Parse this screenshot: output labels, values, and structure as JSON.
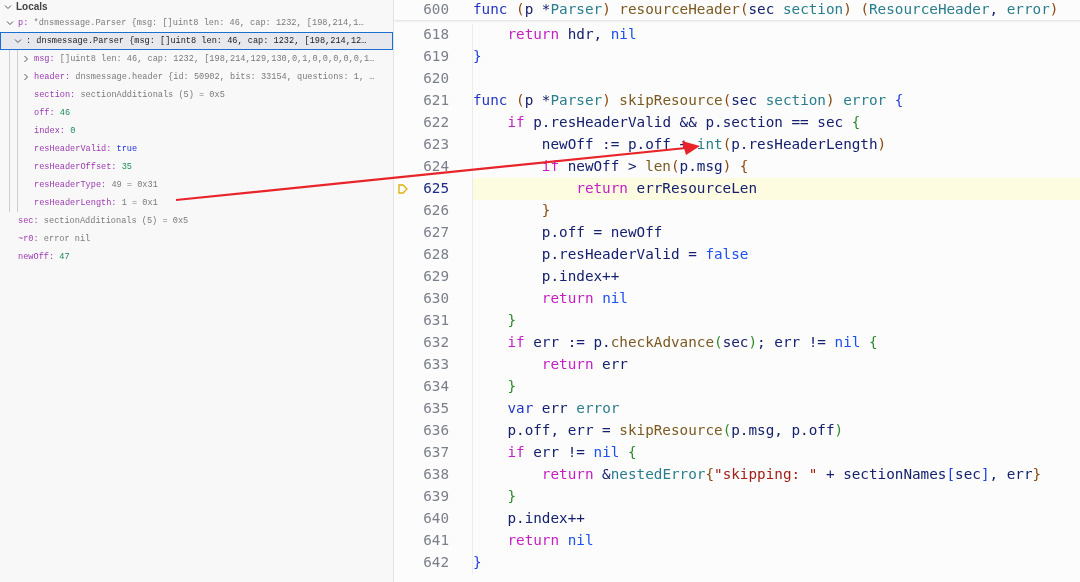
{
  "variables_panel": {
    "section_title": "Locals",
    "section_expanded": true,
    "variables": [
      {
        "name": "p:",
        "value": "*dnsmessage.Parser {msg: []uint8 len: 46, cap: 1232, [198,214,1…",
        "kind": "plain",
        "expanded": true,
        "selected": false,
        "children": [
          {
            "value": ": dnsmessage.Parser {msg: []uint8 len: 46, cap: 1232, [198,214,12…",
            "kind": "strong",
            "expanded": true,
            "selected": true,
            "children": [
              {
                "name": "msg:",
                "value": "[]uint8 len: 46, cap: 1232, [198,214,129,130,0,1,0,0,0,0,0,1…",
                "kind": "plain",
                "expanded": false,
                "selected": false
              },
              {
                "name": "header:",
                "value": "dnsmessage.header {id: 50902, bits: 33154, questions: 1, …",
                "kind": "plain",
                "expanded": false,
                "selected": false
              },
              {
                "name": "section:",
                "value": "sectionAdditionals (5) = 0x5",
                "kind": "plain",
                "selected": false
              },
              {
                "name": "off:",
                "value": "46",
                "kind": "number",
                "selected": false
              },
              {
                "name": "index:",
                "value": "0",
                "kind": "number",
                "selected": false
              },
              {
                "name": "resHeaderValid:",
                "value": "true",
                "kind": "bool",
                "selected": false
              },
              {
                "name": "resHeaderOffset:",
                "value": "35",
                "kind": "number",
                "selected": false
              },
              {
                "name": "resHeaderType:",
                "value": "49 = 0x31",
                "kind": "plain",
                "selected": false
              },
              {
                "name": "resHeaderLength:",
                "value": "1 = 0x1",
                "kind": "plain",
                "selected": false
              }
            ]
          }
        ]
      },
      {
        "name": "sec:",
        "value": "sectionAdditionals (5) = 0x5",
        "kind": "plain",
        "selected": false
      },
      {
        "name": "~r0:",
        "value": "error nil",
        "kind": "plain",
        "selected": false
      },
      {
        "name": "newOff:",
        "value": "47",
        "kind": "number",
        "selected": false
      }
    ]
  },
  "editor": {
    "sticky_line": {
      "number": "600",
      "tokens": [
        {
          "kind": "kw1",
          "text": "func "
        },
        {
          "kind": "b2",
          "text": "("
        },
        {
          "kind": "id",
          "text": "p *"
        },
        {
          "kind": "type",
          "text": "Parser"
        },
        {
          "kind": "b2",
          "text": ") "
        },
        {
          "kind": "fn",
          "text": "resourceHeader"
        },
        {
          "kind": "b2",
          "text": "("
        },
        {
          "kind": "id",
          "text": "sec "
        },
        {
          "kind": "type",
          "text": "section"
        },
        {
          "kind": "b2",
          "text": ") ("
        },
        {
          "kind": "type",
          "text": "ResourceHeader"
        },
        {
          "kind": "id",
          "text": ", "
        },
        {
          "kind": "type",
          "text": "error"
        },
        {
          "kind": "b2",
          "text": ")"
        }
      ]
    },
    "lines": [
      {
        "number": "618",
        "current": false,
        "tokens": [
          {
            "kind": "kw2",
            "text": "    return"
          },
          {
            "kind": "id",
            "text": " hdr, "
          },
          {
            "kind": "lit",
            "text": "nil"
          }
        ]
      },
      {
        "number": "619",
        "current": false,
        "tokens": [
          {
            "kind": "b3",
            "text": "}"
          }
        ]
      },
      {
        "number": "620",
        "current": false
      },
      {
        "number": "621",
        "current": false,
        "tokens": [
          {
            "kind": "kw1",
            "text": "func "
          },
          {
            "kind": "b2",
            "text": "("
          },
          {
            "kind": "id",
            "text": "p *"
          },
          {
            "kind": "type",
            "text": "Parser"
          },
          {
            "kind": "b2",
            "text": ") "
          },
          {
            "kind": "fn",
            "text": "skipResource"
          },
          {
            "kind": "b2",
            "text": "("
          },
          {
            "kind": "id",
            "text": "sec "
          },
          {
            "kind": "type",
            "text": "section"
          },
          {
            "kind": "b2",
            "text": ") "
          },
          {
            "kind": "type",
            "text": "error "
          },
          {
            "kind": "b3",
            "text": "{"
          }
        ]
      },
      {
        "number": "622",
        "current": false,
        "tokens": [
          {
            "kind": "kw2",
            "text": "    if"
          },
          {
            "kind": "id",
            "text": " p.resHeaderValid && p.section == sec "
          },
          {
            "kind": "b1",
            "text": "{"
          }
        ]
      },
      {
        "number": "623",
        "current": false,
        "tokens": [
          {
            "kind": "id",
            "text": "        newOff := p.off + "
          },
          {
            "kind": "type",
            "text": "int"
          },
          {
            "kind": "b2",
            "text": "("
          },
          {
            "kind": "id",
            "text": "p.resHeaderLength"
          },
          {
            "kind": "b2",
            "text": ")"
          }
        ]
      },
      {
        "number": "624",
        "current": false,
        "tokens": [
          {
            "kind": "kw2",
            "text": "        if"
          },
          {
            "kind": "id",
            "text": " newOff > "
          },
          {
            "kind": "fn",
            "text": "len"
          },
          {
            "kind": "b2",
            "text": "("
          },
          {
            "kind": "id",
            "text": "p.msg"
          },
          {
            "kind": "b2",
            "text": ") {"
          }
        ]
      },
      {
        "number": "625",
        "current": true,
        "tokens": [
          {
            "kind": "kw2",
            "text": "            return"
          },
          {
            "kind": "id",
            "text": " errResourceLen"
          }
        ]
      },
      {
        "number": "626",
        "current": false,
        "tokens": [
          {
            "kind": "b2",
            "text": "        }"
          }
        ]
      },
      {
        "number": "627",
        "current": false,
        "tokens": [
          {
            "kind": "id",
            "text": "        p.off = newOff"
          }
        ]
      },
      {
        "number": "628",
        "current": false,
        "tokens": [
          {
            "kind": "id",
            "text": "        p.resHeaderValid = "
          },
          {
            "kind": "lit",
            "text": "false"
          }
        ]
      },
      {
        "number": "629",
        "current": false,
        "tokens": [
          {
            "kind": "id",
            "text": "        p.index++"
          }
        ]
      },
      {
        "number": "630",
        "current": false,
        "tokens": [
          {
            "kind": "kw2",
            "text": "        return "
          },
          {
            "kind": "lit",
            "text": "nil"
          }
        ]
      },
      {
        "number": "631",
        "current": false,
        "tokens": [
          {
            "kind": "b1",
            "text": "    }"
          }
        ]
      },
      {
        "number": "632",
        "current": false,
        "tokens": [
          {
            "kind": "kw2",
            "text": "    if"
          },
          {
            "kind": "id",
            "text": " err := p."
          },
          {
            "kind": "fn",
            "text": "checkAdvance"
          },
          {
            "kind": "b1",
            "text": "("
          },
          {
            "kind": "id",
            "text": "sec"
          },
          {
            "kind": "b1",
            "text": ")"
          },
          {
            "kind": "id",
            "text": "; err != "
          },
          {
            "kind": "lit",
            "text": "nil "
          },
          {
            "kind": "b1",
            "text": "{"
          }
        ]
      },
      {
        "number": "633",
        "current": false,
        "tokens": [
          {
            "kind": "kw2",
            "text": "        return"
          },
          {
            "kind": "id",
            "text": " err"
          }
        ]
      },
      {
        "number": "634",
        "current": false,
        "tokens": [
          {
            "kind": "b1",
            "text": "    }"
          }
        ]
      },
      {
        "number": "635",
        "current": false,
        "tokens": [
          {
            "kind": "kw1",
            "text": "    var"
          },
          {
            "kind": "id",
            "text": " err "
          },
          {
            "kind": "type",
            "text": "error"
          }
        ]
      },
      {
        "number": "636",
        "current": false,
        "tokens": [
          {
            "kind": "id",
            "text": "    p.off, err = "
          },
          {
            "kind": "fn",
            "text": "skipResource"
          },
          {
            "kind": "b1",
            "text": "("
          },
          {
            "kind": "id",
            "text": "p.msg, p.off"
          },
          {
            "kind": "b1",
            "text": ")"
          }
        ]
      },
      {
        "number": "637",
        "current": false,
        "tokens": [
          {
            "kind": "kw2",
            "text": "    if"
          },
          {
            "kind": "id",
            "text": " err != "
          },
          {
            "kind": "lit",
            "text": "nil "
          },
          {
            "kind": "b1",
            "text": "{"
          }
        ]
      },
      {
        "number": "638",
        "current": false,
        "tokens": [
          {
            "kind": "kw2",
            "text": "        return"
          },
          {
            "kind": "id",
            "text": " &"
          },
          {
            "kind": "type",
            "text": "nestedError"
          },
          {
            "kind": "b2",
            "text": "{"
          },
          {
            "kind": "str",
            "text": "\"skipping: \""
          },
          {
            "kind": "id",
            "text": " + sectionNames"
          },
          {
            "kind": "b3",
            "text": "["
          },
          {
            "kind": "id",
            "text": "sec"
          },
          {
            "kind": "b3",
            "text": "]"
          },
          {
            "kind": "id",
            "text": ", err"
          },
          {
            "kind": "b2",
            "text": "}"
          }
        ]
      },
      {
        "number": "639",
        "current": false,
        "tokens": [
          {
            "kind": "b1",
            "text": "    }"
          }
        ]
      },
      {
        "number": "640",
        "current": false,
        "tokens": [
          {
            "kind": "id",
            "text": "    p.index++"
          }
        ]
      },
      {
        "number": "641",
        "current": false,
        "tokens": [
          {
            "kind": "kw2",
            "text": "    return "
          },
          {
            "kind": "lit",
            "text": "nil"
          }
        ]
      },
      {
        "number": "642",
        "current": false,
        "tokens": [
          {
            "kind": "b3",
            "text": "}"
          }
        ]
      }
    ]
  }
}
